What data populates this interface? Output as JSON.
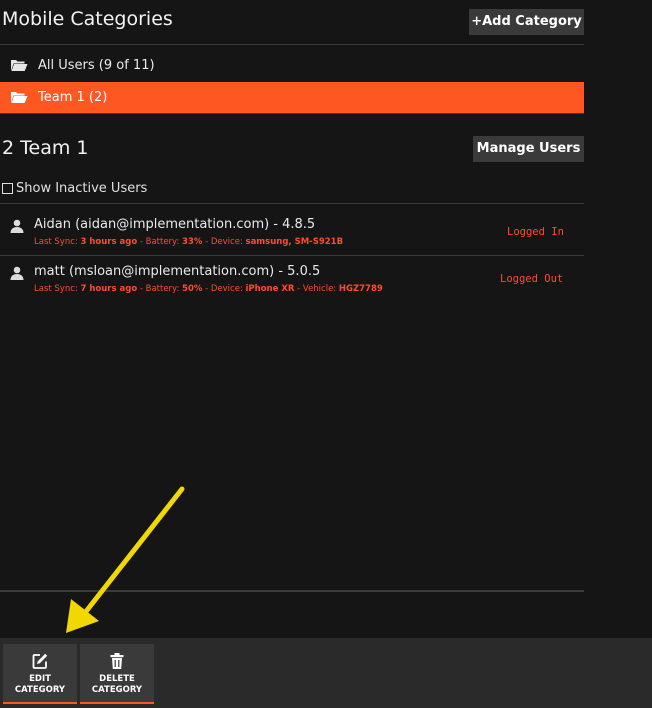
{
  "header": {
    "title": "Mobile Categories",
    "add_button": "+Add Category"
  },
  "categories": [
    {
      "label": "All Users (9 of 11)",
      "active": false,
      "icon": "folder-open-icon"
    },
    {
      "label": "Team 1 (2)",
      "active": true,
      "icon": "folder-open-icon"
    }
  ],
  "team": {
    "title": "2 Team 1",
    "manage_button": "Manage Users",
    "show_inactive_label": "Show Inactive Users",
    "show_inactive_checked": false
  },
  "users": [
    {
      "name": "Aidan (aidan@implementation.com) - 4.8.5",
      "last_sync_label": "Last Sync: ",
      "last_sync": "3 hours ago",
      "battery_label": " - Battery: ",
      "battery": "33%",
      "device_label": " - Device: ",
      "device": "samsung, SM-S921B",
      "vehicle_label": "",
      "vehicle": "",
      "status": "Logged In"
    },
    {
      "name": "matt (msloan@implementation.com) - 5.0.5",
      "last_sync_label": "Last Sync: ",
      "last_sync": "7 hours ago",
      "battery_label": " - Battery: ",
      "battery": "50%",
      "device_label": " - Device: ",
      "device": "iPhone XR",
      "vehicle_label": " - Vehicle: ",
      "vehicle": "HGZ7789",
      "status": "Logged Out"
    }
  ],
  "toolbar": {
    "edit_label": "EDIT\nCATEGORY",
    "edit_icon": "edit-icon",
    "delete_label": "DELETE\nCATEGORY",
    "delete_icon": "trash-icon"
  },
  "colors": {
    "accent": "#ff5722",
    "status_text": "#ff4c2e",
    "background": "#151515",
    "button": "#3a3a3a",
    "annotation_arrow": "#f0d800"
  }
}
